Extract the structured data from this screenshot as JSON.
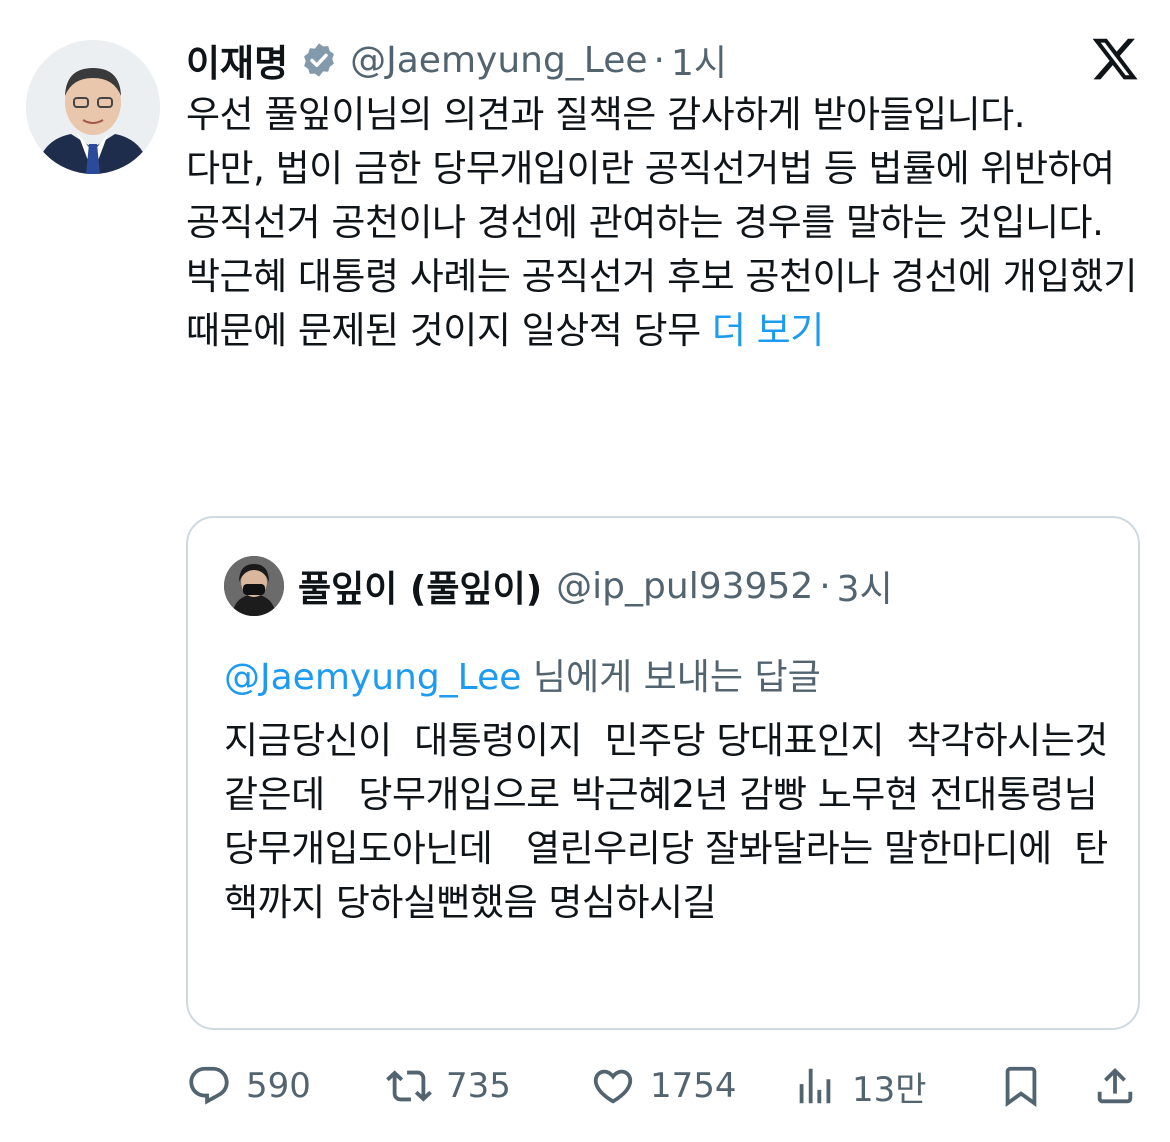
{
  "tweet": {
    "author_name": "이재명",
    "author_handle": "@Jaemyung_Lee",
    "separator": "·",
    "time": "1시",
    "paragraphs": [
      "우선 풀잎이님의 의견과 질책은 감사하게 받아들입니다.",
      "다만, 법이 금한 당무개입이란 공직선거법 등 법률에 위반하여 공직선거 공천이나 경선에 관여하는 경우를 말하는 것입니다.",
      "박근혜 대통령 사례는 공직선거 후보 공천이나 경선에 개입했기 때문에 문제된 것이지 일상적 당무"
    ],
    "more_label": "더 보기"
  },
  "quote": {
    "author_name": "풀잎이 (풀잎이)",
    "author_handle": "@ip_pul93952",
    "separator": "·",
    "time": "3시",
    "reply_mention": "@Jaemyung_Lee",
    "reply_suffix": " 님에게 보내는 답글",
    "text": "지금당신이  대통령이지  민주당 당대표인지  착각하시는것같은데   당무개입으로 박근혜2년 감빵 노무현 전대통령님   당무개입도아닌데   열린우리당 잘봐달라는 말한마디에  탄핵까지 당하실뻔했음 명심하시길"
  },
  "actions": {
    "replies": "590",
    "retweets": "735",
    "likes": "1754",
    "views": "13만"
  },
  "icons": {
    "verified": "verified-badge-icon",
    "logo": "x-logo-icon",
    "reply": "reply-icon",
    "retweet": "retweet-icon",
    "like": "heart-icon",
    "views": "views-icon",
    "bookmark": "bookmark-icon",
    "share": "share-icon"
  },
  "colors": {
    "link": "#1d9bf0",
    "secondary_text": "#536471",
    "primary_text": "#0f1419",
    "border": "#cfd9de"
  }
}
